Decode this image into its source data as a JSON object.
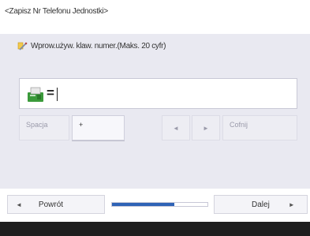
{
  "header": {
    "title": "<Zapisz Nr Telefonu Jednostki>"
  },
  "prompt": {
    "text": "Wprow.używ. klaw. numer.(Maks. 20 cyfr)",
    "icon": "pencil-icon"
  },
  "input": {
    "prefix": "=",
    "value": "",
    "icon": "fax-icon"
  },
  "keys": {
    "space_label": "Spacja",
    "plus_label": "+",
    "left_arrow": "◄",
    "right_arrow": "►",
    "back_label": "Cofnij"
  },
  "footer": {
    "back_label": "Powrót",
    "back_arrow": "◄",
    "next_label": "Dalej",
    "next_arrow": "►",
    "progress_fraction": 0.65
  },
  "colors": {
    "accent": "#2f63b6",
    "panel": "#e9e9f1"
  }
}
